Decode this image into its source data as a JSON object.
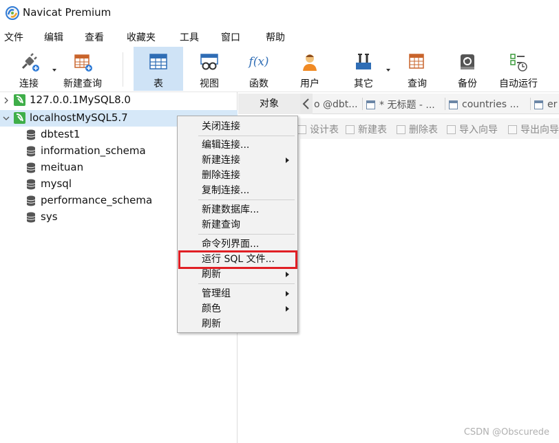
{
  "window": {
    "title": "Navicat Premium"
  },
  "menu": [
    "文件",
    "编辑",
    "查看",
    "收藏夹",
    "工具",
    "窗口",
    "帮助"
  ],
  "toolbar": {
    "connect": "连接",
    "new_query": "新建查询",
    "table": "表",
    "view": "视图",
    "function": "函数",
    "user": "用户",
    "other": "其它",
    "query": "查询",
    "backup": "备份",
    "automation": "自动运行",
    "function_glyph": "f(x)"
  },
  "tree": {
    "connections": [
      {
        "label": "127.0.0.1MySQL8.0",
        "expanded": false
      },
      {
        "label": "localhostMySQL5.7",
        "expanded": true
      }
    ],
    "databases": [
      "dbtest1",
      "information_schema",
      "meituan",
      "mysql",
      "performance_schema",
      "sys"
    ]
  },
  "tabs": {
    "objects": "对象",
    "items": [
      "o @dbt...",
      "* 无标题 - ...",
      "countries ...",
      "er"
    ]
  },
  "subtoolbar": [
    "设计表",
    "新建表",
    "删除表",
    "导入向导",
    "导出向导"
  ],
  "context_menu": {
    "close_connection": "关闭连接",
    "edit_connection": "编辑连接...",
    "new_connection": "新建连接",
    "delete_connection": "删除连接",
    "copy_connection": "复制连接...",
    "new_database": "新建数据库...",
    "new_query": "新建查询",
    "command_line": "命令列界面...",
    "run_sql_file": "运行 SQL 文件...",
    "refresh_1": "刷新",
    "manage_group": "管理组",
    "color": "颜色",
    "refresh_2": "刷新"
  },
  "colors": {
    "highlight": "#e01e24",
    "selection": "#d6e8f8",
    "active_tool": "#cfe3f6"
  },
  "watermark": "CSDN @Obscurede"
}
